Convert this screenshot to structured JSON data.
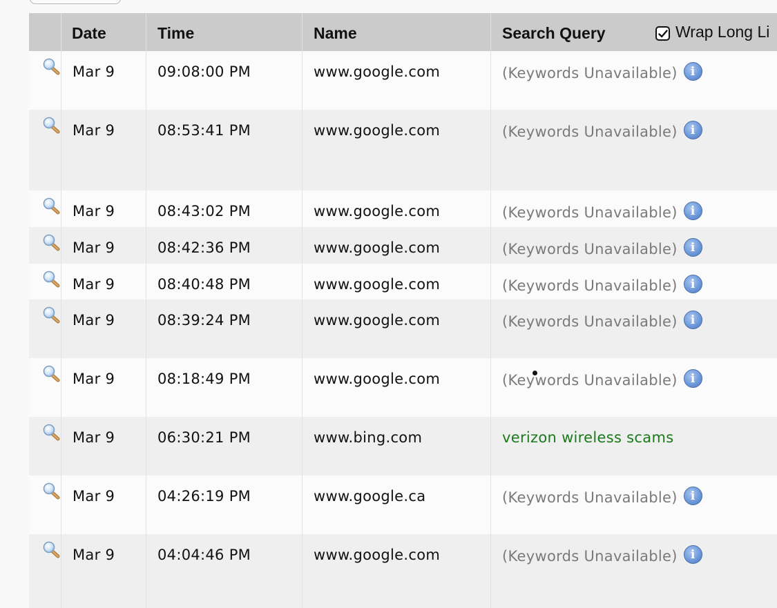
{
  "table": {
    "headers": {
      "date": "Date",
      "time": "Time",
      "name": "Name",
      "search_query": "Search Query",
      "wrap_long_lines": "Wrap Long Li"
    },
    "wrap_long_lines_checked": true,
    "rows": [
      {
        "date": "Mar 9",
        "time": "09:08:00 PM",
        "name": "www.google.com",
        "query": "(Keywords Unavailable)",
        "keywords_available": false
      },
      {
        "date": "Mar 9",
        "time": "08:53:41 PM",
        "name": "www.google.com",
        "query": "(Keywords Unavailable)",
        "keywords_available": false
      },
      {
        "date": "Mar 9",
        "time": "08:43:02 PM",
        "name": "www.google.com",
        "query": "(Keywords Unavailable)",
        "keywords_available": false
      },
      {
        "date": "Mar 9",
        "time": "08:42:36 PM",
        "name": "www.google.com",
        "query": "(Keywords Unavailable)",
        "keywords_available": false
      },
      {
        "date": "Mar 9",
        "time": "08:40:48 PM",
        "name": "www.google.com",
        "query": "(Keywords Unavailable)",
        "keywords_available": false
      },
      {
        "date": "Mar 9",
        "time": "08:39:24 PM",
        "name": "www.google.com",
        "query": "(Keywords Unavailable)",
        "keywords_available": false
      },
      {
        "date": "Mar 9",
        "time": "08:18:49 PM",
        "name": "www.google.com",
        "query": "(Keywords Unavailable)",
        "keywords_available": false
      },
      {
        "date": "Mar 9",
        "time": "06:30:21 PM",
        "name": "www.bing.com",
        "query": "verizon wireless scams",
        "keywords_available": true
      },
      {
        "date": "Mar 9",
        "time": "04:26:19 PM",
        "name": "www.google.ca",
        "query": "(Keywords Unavailable)",
        "keywords_available": false
      },
      {
        "date": "Mar 9",
        "time": "04:04:46 PM",
        "name": "www.google.com",
        "query": "(Keywords Unavailable)",
        "keywords_available": false
      }
    ]
  },
  "icons": {
    "row_view": "magnifier-icon",
    "info": "info-icon",
    "checkbox": "checkmark-icon"
  },
  "colors": {
    "header_bg": "#cbcbcb",
    "keywords_available": "#1a7a1a",
    "keywords_unavailable": "#7a7a7a",
    "info_icon": "#6f9bdb"
  }
}
